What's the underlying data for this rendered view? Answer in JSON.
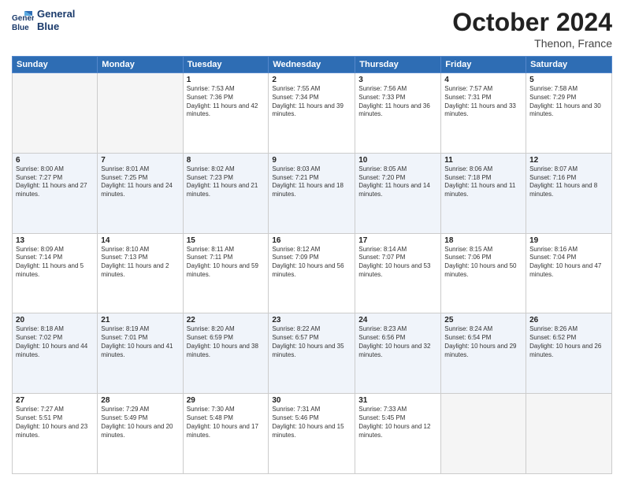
{
  "logo": {
    "line1": "General",
    "line2": "Blue"
  },
  "title": "October 2024",
  "location": "Thenon, France",
  "weekdays": [
    "Sunday",
    "Monday",
    "Tuesday",
    "Wednesday",
    "Thursday",
    "Friday",
    "Saturday"
  ],
  "weeks": [
    [
      {
        "day": "",
        "sunrise": "",
        "sunset": "",
        "daylight": ""
      },
      {
        "day": "",
        "sunrise": "",
        "sunset": "",
        "daylight": ""
      },
      {
        "day": "1",
        "sunrise": "Sunrise: 7:53 AM",
        "sunset": "Sunset: 7:36 PM",
        "daylight": "Daylight: 11 hours and 42 minutes."
      },
      {
        "day": "2",
        "sunrise": "Sunrise: 7:55 AM",
        "sunset": "Sunset: 7:34 PM",
        "daylight": "Daylight: 11 hours and 39 minutes."
      },
      {
        "day": "3",
        "sunrise": "Sunrise: 7:56 AM",
        "sunset": "Sunset: 7:33 PM",
        "daylight": "Daylight: 11 hours and 36 minutes."
      },
      {
        "day": "4",
        "sunrise": "Sunrise: 7:57 AM",
        "sunset": "Sunset: 7:31 PM",
        "daylight": "Daylight: 11 hours and 33 minutes."
      },
      {
        "day": "5",
        "sunrise": "Sunrise: 7:58 AM",
        "sunset": "Sunset: 7:29 PM",
        "daylight": "Daylight: 11 hours and 30 minutes."
      }
    ],
    [
      {
        "day": "6",
        "sunrise": "Sunrise: 8:00 AM",
        "sunset": "Sunset: 7:27 PM",
        "daylight": "Daylight: 11 hours and 27 minutes."
      },
      {
        "day": "7",
        "sunrise": "Sunrise: 8:01 AM",
        "sunset": "Sunset: 7:25 PM",
        "daylight": "Daylight: 11 hours and 24 minutes."
      },
      {
        "day": "8",
        "sunrise": "Sunrise: 8:02 AM",
        "sunset": "Sunset: 7:23 PM",
        "daylight": "Daylight: 11 hours and 21 minutes."
      },
      {
        "day": "9",
        "sunrise": "Sunrise: 8:03 AM",
        "sunset": "Sunset: 7:21 PM",
        "daylight": "Daylight: 11 hours and 18 minutes."
      },
      {
        "day": "10",
        "sunrise": "Sunrise: 8:05 AM",
        "sunset": "Sunset: 7:20 PM",
        "daylight": "Daylight: 11 hours and 14 minutes."
      },
      {
        "day": "11",
        "sunrise": "Sunrise: 8:06 AM",
        "sunset": "Sunset: 7:18 PM",
        "daylight": "Daylight: 11 hours and 11 minutes."
      },
      {
        "day": "12",
        "sunrise": "Sunrise: 8:07 AM",
        "sunset": "Sunset: 7:16 PM",
        "daylight": "Daylight: 11 hours and 8 minutes."
      }
    ],
    [
      {
        "day": "13",
        "sunrise": "Sunrise: 8:09 AM",
        "sunset": "Sunset: 7:14 PM",
        "daylight": "Daylight: 11 hours and 5 minutes."
      },
      {
        "day": "14",
        "sunrise": "Sunrise: 8:10 AM",
        "sunset": "Sunset: 7:13 PM",
        "daylight": "Daylight: 11 hours and 2 minutes."
      },
      {
        "day": "15",
        "sunrise": "Sunrise: 8:11 AM",
        "sunset": "Sunset: 7:11 PM",
        "daylight": "Daylight: 10 hours and 59 minutes."
      },
      {
        "day": "16",
        "sunrise": "Sunrise: 8:12 AM",
        "sunset": "Sunset: 7:09 PM",
        "daylight": "Daylight: 10 hours and 56 minutes."
      },
      {
        "day": "17",
        "sunrise": "Sunrise: 8:14 AM",
        "sunset": "Sunset: 7:07 PM",
        "daylight": "Daylight: 10 hours and 53 minutes."
      },
      {
        "day": "18",
        "sunrise": "Sunrise: 8:15 AM",
        "sunset": "Sunset: 7:06 PM",
        "daylight": "Daylight: 10 hours and 50 minutes."
      },
      {
        "day": "19",
        "sunrise": "Sunrise: 8:16 AM",
        "sunset": "Sunset: 7:04 PM",
        "daylight": "Daylight: 10 hours and 47 minutes."
      }
    ],
    [
      {
        "day": "20",
        "sunrise": "Sunrise: 8:18 AM",
        "sunset": "Sunset: 7:02 PM",
        "daylight": "Daylight: 10 hours and 44 minutes."
      },
      {
        "day": "21",
        "sunrise": "Sunrise: 8:19 AM",
        "sunset": "Sunset: 7:01 PM",
        "daylight": "Daylight: 10 hours and 41 minutes."
      },
      {
        "day": "22",
        "sunrise": "Sunrise: 8:20 AM",
        "sunset": "Sunset: 6:59 PM",
        "daylight": "Daylight: 10 hours and 38 minutes."
      },
      {
        "day": "23",
        "sunrise": "Sunrise: 8:22 AM",
        "sunset": "Sunset: 6:57 PM",
        "daylight": "Daylight: 10 hours and 35 minutes."
      },
      {
        "day": "24",
        "sunrise": "Sunrise: 8:23 AM",
        "sunset": "Sunset: 6:56 PM",
        "daylight": "Daylight: 10 hours and 32 minutes."
      },
      {
        "day": "25",
        "sunrise": "Sunrise: 8:24 AM",
        "sunset": "Sunset: 6:54 PM",
        "daylight": "Daylight: 10 hours and 29 minutes."
      },
      {
        "day": "26",
        "sunrise": "Sunrise: 8:26 AM",
        "sunset": "Sunset: 6:52 PM",
        "daylight": "Daylight: 10 hours and 26 minutes."
      }
    ],
    [
      {
        "day": "27",
        "sunrise": "Sunrise: 7:27 AM",
        "sunset": "Sunset: 5:51 PM",
        "daylight": "Daylight: 10 hours and 23 minutes."
      },
      {
        "day": "28",
        "sunrise": "Sunrise: 7:29 AM",
        "sunset": "Sunset: 5:49 PM",
        "daylight": "Daylight: 10 hours and 20 minutes."
      },
      {
        "day": "29",
        "sunrise": "Sunrise: 7:30 AM",
        "sunset": "Sunset: 5:48 PM",
        "daylight": "Daylight: 10 hours and 17 minutes."
      },
      {
        "day": "30",
        "sunrise": "Sunrise: 7:31 AM",
        "sunset": "Sunset: 5:46 PM",
        "daylight": "Daylight: 10 hours and 15 minutes."
      },
      {
        "day": "31",
        "sunrise": "Sunrise: 7:33 AM",
        "sunset": "Sunset: 5:45 PM",
        "daylight": "Daylight: 10 hours and 12 minutes."
      },
      {
        "day": "",
        "sunrise": "",
        "sunset": "",
        "daylight": ""
      },
      {
        "day": "",
        "sunrise": "",
        "sunset": "",
        "daylight": ""
      }
    ]
  ]
}
